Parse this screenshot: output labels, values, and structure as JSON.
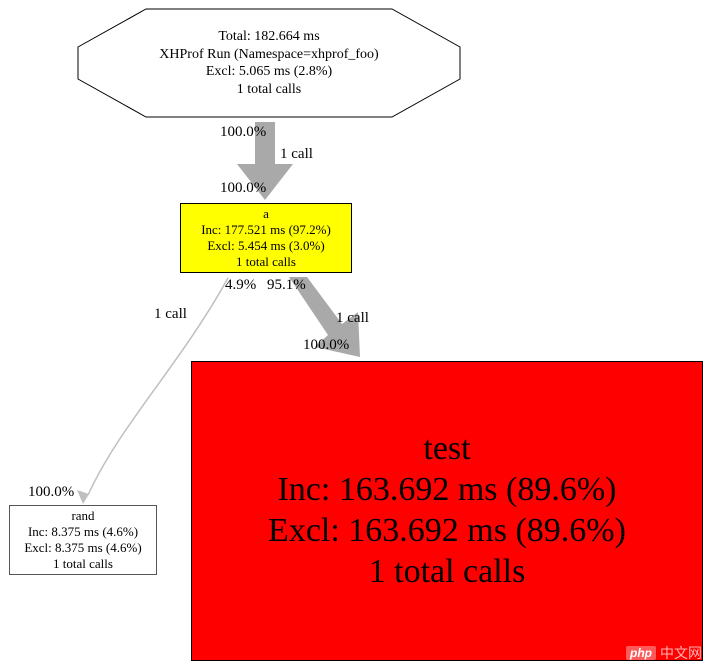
{
  "root": {
    "line1": "Total: 182.664 ms",
    "line2": "XHProf Run (Namespace=xhprof_foo)",
    "line3": "Excl: 5.065 ms (2.8%)",
    "line4": "1 total calls"
  },
  "edge_root_a": {
    "top_pct": "100.0%",
    "calls": "1 call",
    "bottom_pct": "100.0%"
  },
  "node_a": {
    "title": "a",
    "inc": "Inc: 177.521 ms (97.2%)",
    "excl": "Excl: 5.454 ms (3.0%)",
    "calls": "1 total calls"
  },
  "edge_a_rand": {
    "pct_a": "4.9%",
    "calls": "1 call",
    "pct_b": "100.0%"
  },
  "edge_a_test": {
    "pct_a": "95.1%",
    "calls": "1 call",
    "pct_b": "100.0%"
  },
  "node_rand": {
    "title": "rand",
    "inc": "Inc: 8.375 ms (4.6%)",
    "excl": "Excl: 8.375 ms (4.6%)",
    "calls": "1 total calls"
  },
  "node_test": {
    "title": "test",
    "inc": "Inc: 163.692 ms (89.6%)",
    "excl": "Excl: 163.692 ms (89.6%)",
    "calls": "1 total calls"
  },
  "watermark": {
    "badge": "php",
    "text": "中文网"
  }
}
